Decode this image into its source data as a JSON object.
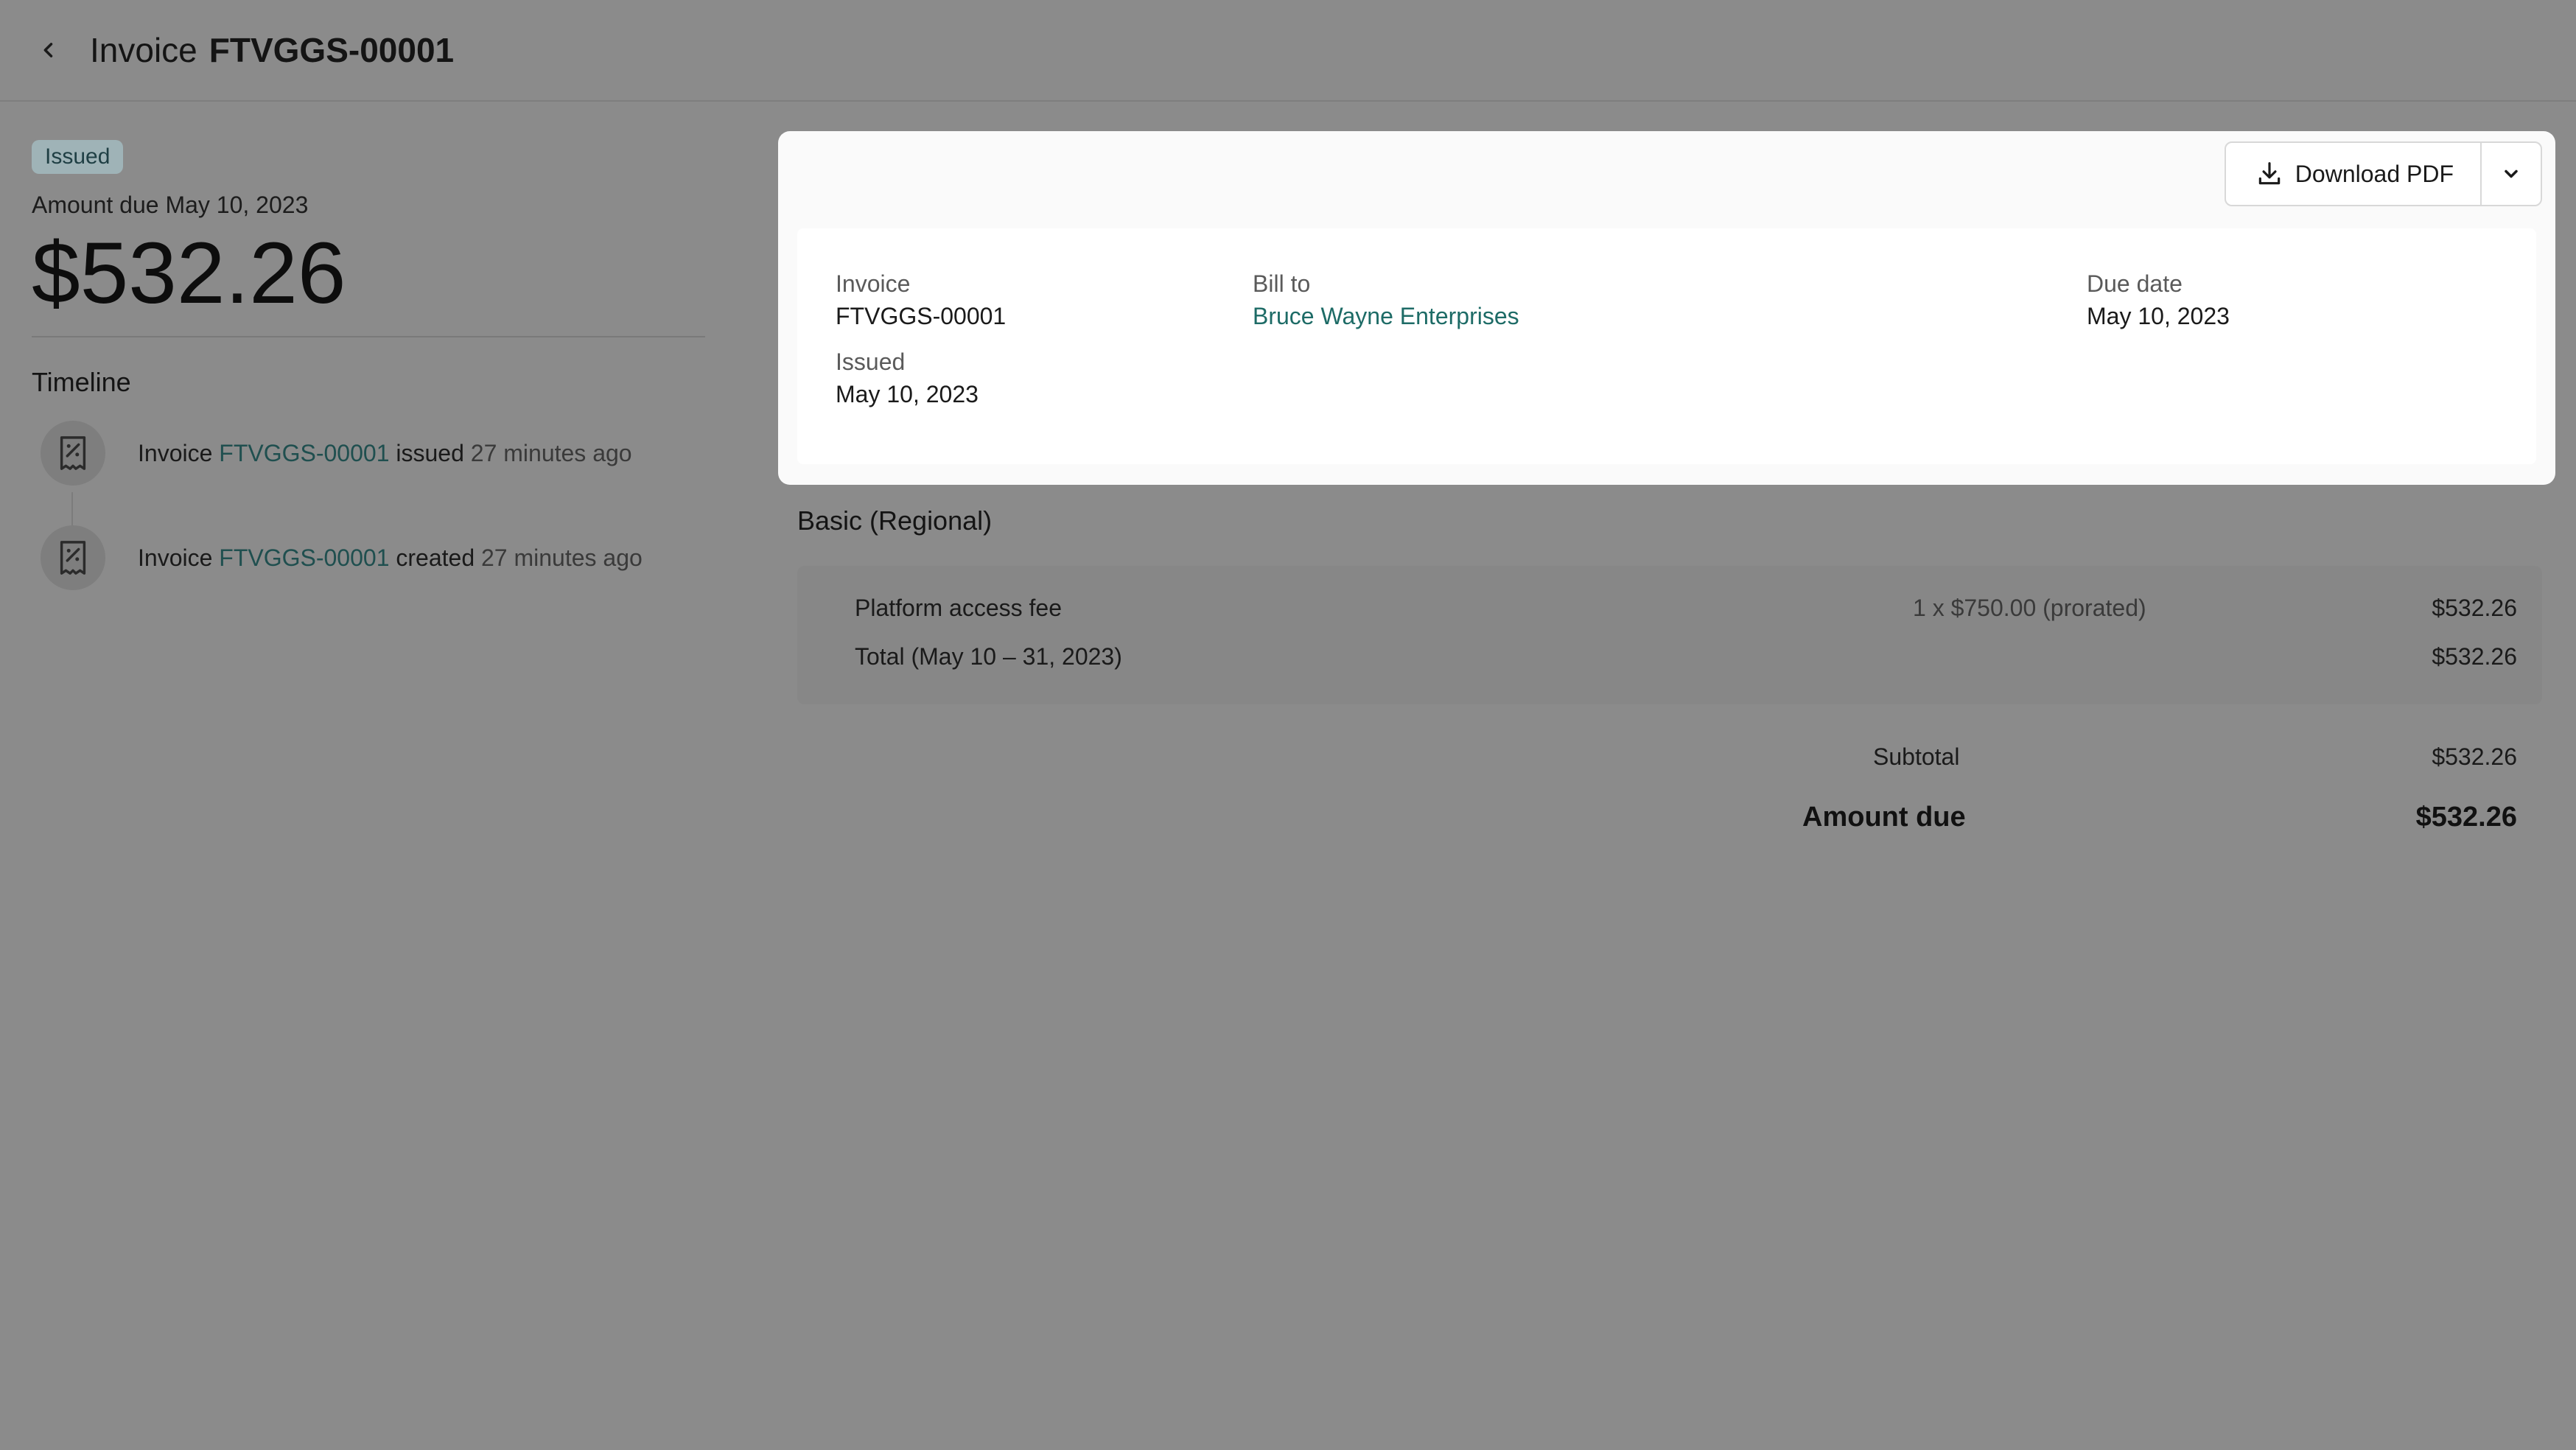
{
  "header": {
    "title_prefix": "Invoice",
    "invoice_id": "FTVGGS-00001"
  },
  "summary": {
    "status_badge": "Issued",
    "amount_due_label": "Amount due May 10, 2023",
    "amount": "$532.26"
  },
  "timeline": {
    "title": "Timeline",
    "events": [
      {
        "prefix": "Invoice",
        "link": "FTVGGS-00001",
        "action": "issued",
        "time": "27 minutes ago"
      },
      {
        "prefix": "Invoice",
        "link": "FTVGGS-00001",
        "action": "created",
        "time": "27 minutes ago"
      }
    ]
  },
  "toolbar": {
    "download_label": "Download PDF"
  },
  "details": {
    "invoice_label": "Invoice",
    "invoice_value": "FTVGGS-00001",
    "issued_label": "Issued",
    "issued_value": "May 10, 2023",
    "bill_to_label": "Bill to",
    "bill_to_value": "Bruce Wayne Enterprises",
    "due_date_label": "Due date",
    "due_date_value": "May 10, 2023"
  },
  "plan": {
    "title": "Basic (Regional)",
    "items": [
      {
        "name": "Platform access fee",
        "quantity": "1 x $750.00 (prorated)",
        "amount": "$532.26"
      }
    ],
    "total_label": "Total (May 10 – 31, 2023)",
    "total_amount": "$532.26"
  },
  "totals": {
    "subtotal_label": "Subtotal",
    "subtotal_value": "$532.26",
    "amount_due_label": "Amount due",
    "amount_due_value": "$532.26"
  }
}
